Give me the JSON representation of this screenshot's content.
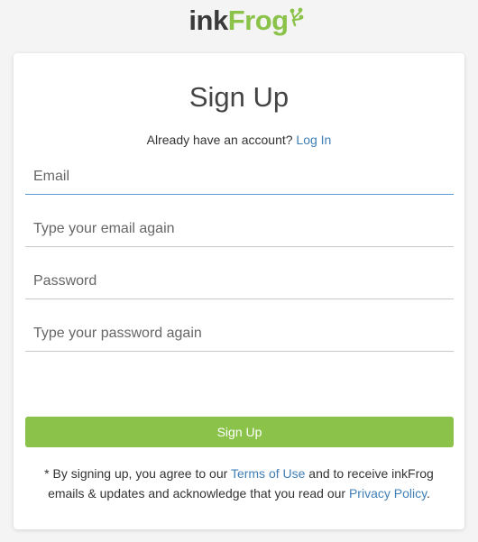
{
  "brand": {
    "name_part1": "ink",
    "name_part2": "Frog",
    "colors": {
      "ink": "#3a3a3a",
      "frog": "#8bc34a"
    }
  },
  "form": {
    "title": "Sign Up",
    "login_prompt": "Already have an account?",
    "login_link": "Log In",
    "fields": [
      {
        "placeholder": "Email",
        "value": "",
        "focused": true
      },
      {
        "placeholder": "Type your email again",
        "value": ""
      },
      {
        "placeholder": "Password",
        "value": ""
      },
      {
        "placeholder": "Type your password again",
        "value": ""
      }
    ],
    "submit_label": "Sign Up",
    "legal": {
      "part1": "* By signing up, you agree to our",
      "terms_link": "Terms of Use",
      "part2": "and to receive inkFrog emails & updates and acknowledge that you read our",
      "privacy_link": "Privacy Policy",
      "end": "."
    }
  },
  "colors": {
    "accent_green": "#8bc34a",
    "link_blue": "#3f7fb6",
    "focus_blue": "#5a9bd5",
    "background": "#f4f4f4"
  }
}
